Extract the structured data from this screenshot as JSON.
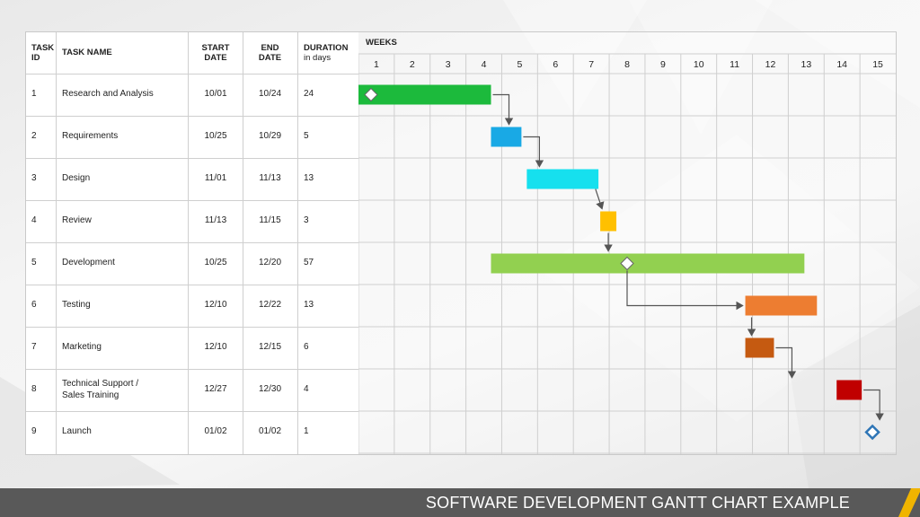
{
  "table": {
    "headers": {
      "id": "TASK ID",
      "id_l1": "TASK",
      "id_l2": "ID",
      "name": "TASK NAME",
      "start_l1": "START",
      "start_l2": "DATE",
      "end_l1": "END",
      "end_l2": "DATE",
      "duration_l1": "DURATION",
      "duration_l2": "in days"
    },
    "rows": [
      {
        "id": "1",
        "name": "Research and Analysis",
        "start": "10/01",
        "end": "10/24",
        "duration": "24"
      },
      {
        "id": "2",
        "name": "Requirements",
        "start": "10/25",
        "end": "10/29",
        "duration": "5"
      },
      {
        "id": "3",
        "name": "Design",
        "start": "11/01",
        "end": "11/13",
        "duration": "13"
      },
      {
        "id": "4",
        "name": "Review",
        "start": "11/13",
        "end": "11/15",
        "duration": "3"
      },
      {
        "id": "5",
        "name": "Development",
        "start": "10/25",
        "end": "12/20",
        "duration": "57"
      },
      {
        "id": "6",
        "name": "Testing",
        "start": "12/10",
        "end": "12/22",
        "duration": "13"
      },
      {
        "id": "7",
        "name": "Marketing",
        "start": "12/10",
        "end": "12/15",
        "duration": "6"
      },
      {
        "id": "8",
        "name": "Technical Support / Sales Training",
        "name_l1": "Technical Support /",
        "name_l2": "Sales Training",
        "start": "12/27",
        "end": "12/30",
        "duration": "4"
      },
      {
        "id": "9",
        "name": "Launch",
        "start": "01/02",
        "end": "01/02",
        "duration": "1"
      }
    ]
  },
  "chart_data": {
    "type": "gantt",
    "title": "SOFTWARE DEVELOPMENT GANTT CHART EXAMPLE",
    "xlabel": "WEEKS",
    "weeks": [
      "1",
      "2",
      "3",
      "4",
      "5",
      "6",
      "7",
      "8",
      "9",
      "10",
      "11",
      "12",
      "13",
      "14",
      "15"
    ],
    "xlim": [
      0,
      15
    ],
    "tasks": [
      {
        "task": "1",
        "start_week": 0.0,
        "end_week": 3.7,
        "color": "#1cba3c",
        "milestone_week": 0.35
      },
      {
        "task": "2",
        "start_week": 3.7,
        "end_week": 4.55,
        "color": "#19a9e5"
      },
      {
        "task": "3",
        "start_week": 4.7,
        "end_week": 6.7,
        "color": "#16e0ee"
      },
      {
        "task": "4",
        "start_week": 6.75,
        "end_week": 7.2,
        "color": "#ffc000"
      },
      {
        "task": "5",
        "start_week": 3.7,
        "end_week": 12.45,
        "color": "#92d050",
        "milestone_week": 7.5
      },
      {
        "task": "6",
        "start_week": 10.8,
        "end_week": 12.8,
        "color": "#ed7d31"
      },
      {
        "task": "7",
        "start_week": 10.8,
        "end_week": 11.6,
        "color": "#c55a11"
      },
      {
        "task": "8",
        "start_week": 13.35,
        "end_week": 14.05,
        "color": "#c00000"
      },
      {
        "task": "9",
        "milestone_week": 14.35,
        "milestone_color": "#2e75b6"
      }
    ],
    "dependencies": [
      [
        1,
        2
      ],
      [
        2,
        3
      ],
      [
        3,
        4
      ],
      [
        4,
        5
      ],
      [
        5,
        6
      ],
      [
        6,
        7
      ],
      [
        7,
        8
      ],
      [
        8,
        9
      ]
    ]
  },
  "footer": {
    "title": "SOFTWARE DEVELOPMENT GANTT CHART EXAMPLE"
  },
  "colors": {
    "footer_bg": "#595959",
    "accent_stripe": "#f0b400",
    "grid": "#cfcfcf",
    "arrow": "#555555"
  }
}
